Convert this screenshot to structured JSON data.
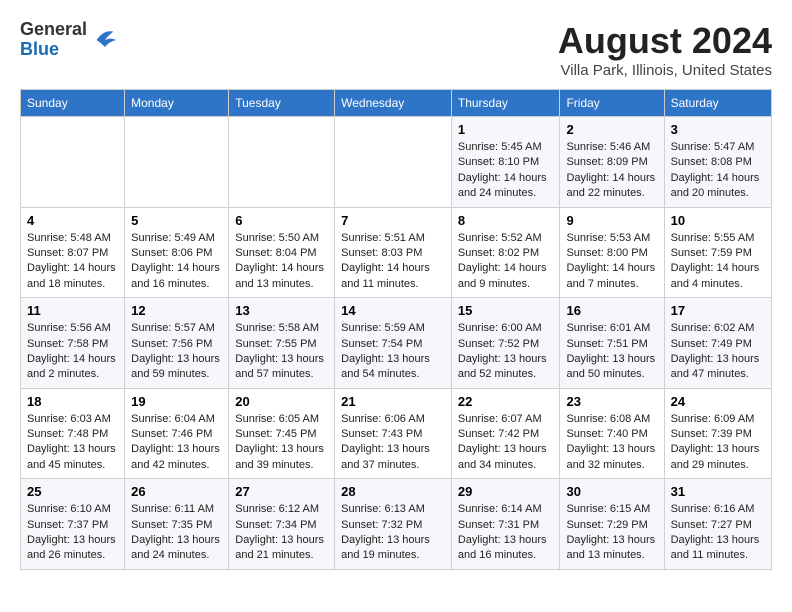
{
  "header": {
    "logo_general": "General",
    "logo_blue": "Blue",
    "month_title": "August 2024",
    "location": "Villa Park, Illinois, United States"
  },
  "calendar": {
    "days_of_week": [
      "Sunday",
      "Monday",
      "Tuesday",
      "Wednesday",
      "Thursday",
      "Friday",
      "Saturday"
    ],
    "weeks": [
      [
        {
          "day": "",
          "info": ""
        },
        {
          "day": "",
          "info": ""
        },
        {
          "day": "",
          "info": ""
        },
        {
          "day": "",
          "info": ""
        },
        {
          "day": "1",
          "info": "Sunrise: 5:45 AM\nSunset: 8:10 PM\nDaylight: 14 hours and 24 minutes."
        },
        {
          "day": "2",
          "info": "Sunrise: 5:46 AM\nSunset: 8:09 PM\nDaylight: 14 hours and 22 minutes."
        },
        {
          "day": "3",
          "info": "Sunrise: 5:47 AM\nSunset: 8:08 PM\nDaylight: 14 hours and 20 minutes."
        }
      ],
      [
        {
          "day": "4",
          "info": "Sunrise: 5:48 AM\nSunset: 8:07 PM\nDaylight: 14 hours and 18 minutes."
        },
        {
          "day": "5",
          "info": "Sunrise: 5:49 AM\nSunset: 8:06 PM\nDaylight: 14 hours and 16 minutes."
        },
        {
          "day": "6",
          "info": "Sunrise: 5:50 AM\nSunset: 8:04 PM\nDaylight: 14 hours and 13 minutes."
        },
        {
          "day": "7",
          "info": "Sunrise: 5:51 AM\nSunset: 8:03 PM\nDaylight: 14 hours and 11 minutes."
        },
        {
          "day": "8",
          "info": "Sunrise: 5:52 AM\nSunset: 8:02 PM\nDaylight: 14 hours and 9 minutes."
        },
        {
          "day": "9",
          "info": "Sunrise: 5:53 AM\nSunset: 8:00 PM\nDaylight: 14 hours and 7 minutes."
        },
        {
          "day": "10",
          "info": "Sunrise: 5:55 AM\nSunset: 7:59 PM\nDaylight: 14 hours and 4 minutes."
        }
      ],
      [
        {
          "day": "11",
          "info": "Sunrise: 5:56 AM\nSunset: 7:58 PM\nDaylight: 14 hours and 2 minutes."
        },
        {
          "day": "12",
          "info": "Sunrise: 5:57 AM\nSunset: 7:56 PM\nDaylight: 13 hours and 59 minutes."
        },
        {
          "day": "13",
          "info": "Sunrise: 5:58 AM\nSunset: 7:55 PM\nDaylight: 13 hours and 57 minutes."
        },
        {
          "day": "14",
          "info": "Sunrise: 5:59 AM\nSunset: 7:54 PM\nDaylight: 13 hours and 54 minutes."
        },
        {
          "day": "15",
          "info": "Sunrise: 6:00 AM\nSunset: 7:52 PM\nDaylight: 13 hours and 52 minutes."
        },
        {
          "day": "16",
          "info": "Sunrise: 6:01 AM\nSunset: 7:51 PM\nDaylight: 13 hours and 50 minutes."
        },
        {
          "day": "17",
          "info": "Sunrise: 6:02 AM\nSunset: 7:49 PM\nDaylight: 13 hours and 47 minutes."
        }
      ],
      [
        {
          "day": "18",
          "info": "Sunrise: 6:03 AM\nSunset: 7:48 PM\nDaylight: 13 hours and 45 minutes."
        },
        {
          "day": "19",
          "info": "Sunrise: 6:04 AM\nSunset: 7:46 PM\nDaylight: 13 hours and 42 minutes."
        },
        {
          "day": "20",
          "info": "Sunrise: 6:05 AM\nSunset: 7:45 PM\nDaylight: 13 hours and 39 minutes."
        },
        {
          "day": "21",
          "info": "Sunrise: 6:06 AM\nSunset: 7:43 PM\nDaylight: 13 hours and 37 minutes."
        },
        {
          "day": "22",
          "info": "Sunrise: 6:07 AM\nSunset: 7:42 PM\nDaylight: 13 hours and 34 minutes."
        },
        {
          "day": "23",
          "info": "Sunrise: 6:08 AM\nSunset: 7:40 PM\nDaylight: 13 hours and 32 minutes."
        },
        {
          "day": "24",
          "info": "Sunrise: 6:09 AM\nSunset: 7:39 PM\nDaylight: 13 hours and 29 minutes."
        }
      ],
      [
        {
          "day": "25",
          "info": "Sunrise: 6:10 AM\nSunset: 7:37 PM\nDaylight: 13 hours and 26 minutes."
        },
        {
          "day": "26",
          "info": "Sunrise: 6:11 AM\nSunset: 7:35 PM\nDaylight: 13 hours and 24 minutes."
        },
        {
          "day": "27",
          "info": "Sunrise: 6:12 AM\nSunset: 7:34 PM\nDaylight: 13 hours and 21 minutes."
        },
        {
          "day": "28",
          "info": "Sunrise: 6:13 AM\nSunset: 7:32 PM\nDaylight: 13 hours and 19 minutes."
        },
        {
          "day": "29",
          "info": "Sunrise: 6:14 AM\nSunset: 7:31 PM\nDaylight: 13 hours and 16 minutes."
        },
        {
          "day": "30",
          "info": "Sunrise: 6:15 AM\nSunset: 7:29 PM\nDaylight: 13 hours and 13 minutes."
        },
        {
          "day": "31",
          "info": "Sunrise: 6:16 AM\nSunset: 7:27 PM\nDaylight: 13 hours and 11 minutes."
        }
      ]
    ]
  }
}
